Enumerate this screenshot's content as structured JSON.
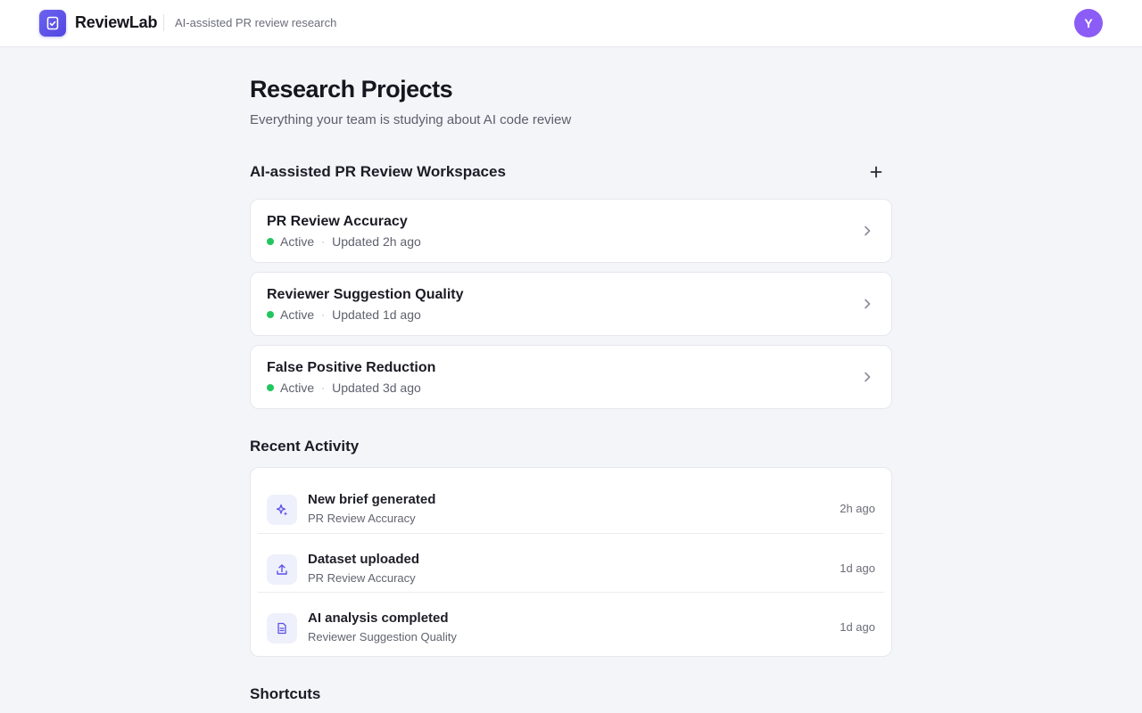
{
  "app": {
    "name": "ReviewLab",
    "tagline": "AI-assisted PR review research",
    "user_initial": "Y",
    "accent_color": "#5b51e8",
    "avatar_color": "#8b5cf6"
  },
  "page": {
    "title": "Research Projects",
    "subtitle": "Everything your team is studying about AI code review"
  },
  "workspaces": {
    "section_title": "AI-assisted PR Review Workspaces",
    "add_icon": "plus-icon",
    "projects": [
      {
        "name": "PR Review Accuracy",
        "status": "Active",
        "updated": "Updated 2h ago",
        "status_color": "#22c55e"
      },
      {
        "name": "Reviewer Suggestion Quality",
        "status": "Active",
        "updated": "Updated 1d ago",
        "status_color": "#22c55e"
      },
      {
        "name": "False Positive Reduction",
        "status": "Active",
        "updated": "Updated 3d ago",
        "status_color": "#22c55e"
      }
    ]
  },
  "activity": {
    "section_title": "Recent Activity",
    "items": [
      {
        "icon": "sparkle-icon",
        "title": "New brief generated",
        "project": "PR Review Accuracy",
        "time": "2h ago"
      },
      {
        "icon": "upload-icon",
        "title": "Dataset uploaded",
        "project": "PR Review Accuracy",
        "time": "1d ago"
      },
      {
        "icon": "document-icon",
        "title": "AI analysis completed",
        "project": "Reviewer Suggestion Quality",
        "time": "1d ago"
      }
    ]
  },
  "shortcuts": {
    "section_title": "Shortcuts"
  }
}
